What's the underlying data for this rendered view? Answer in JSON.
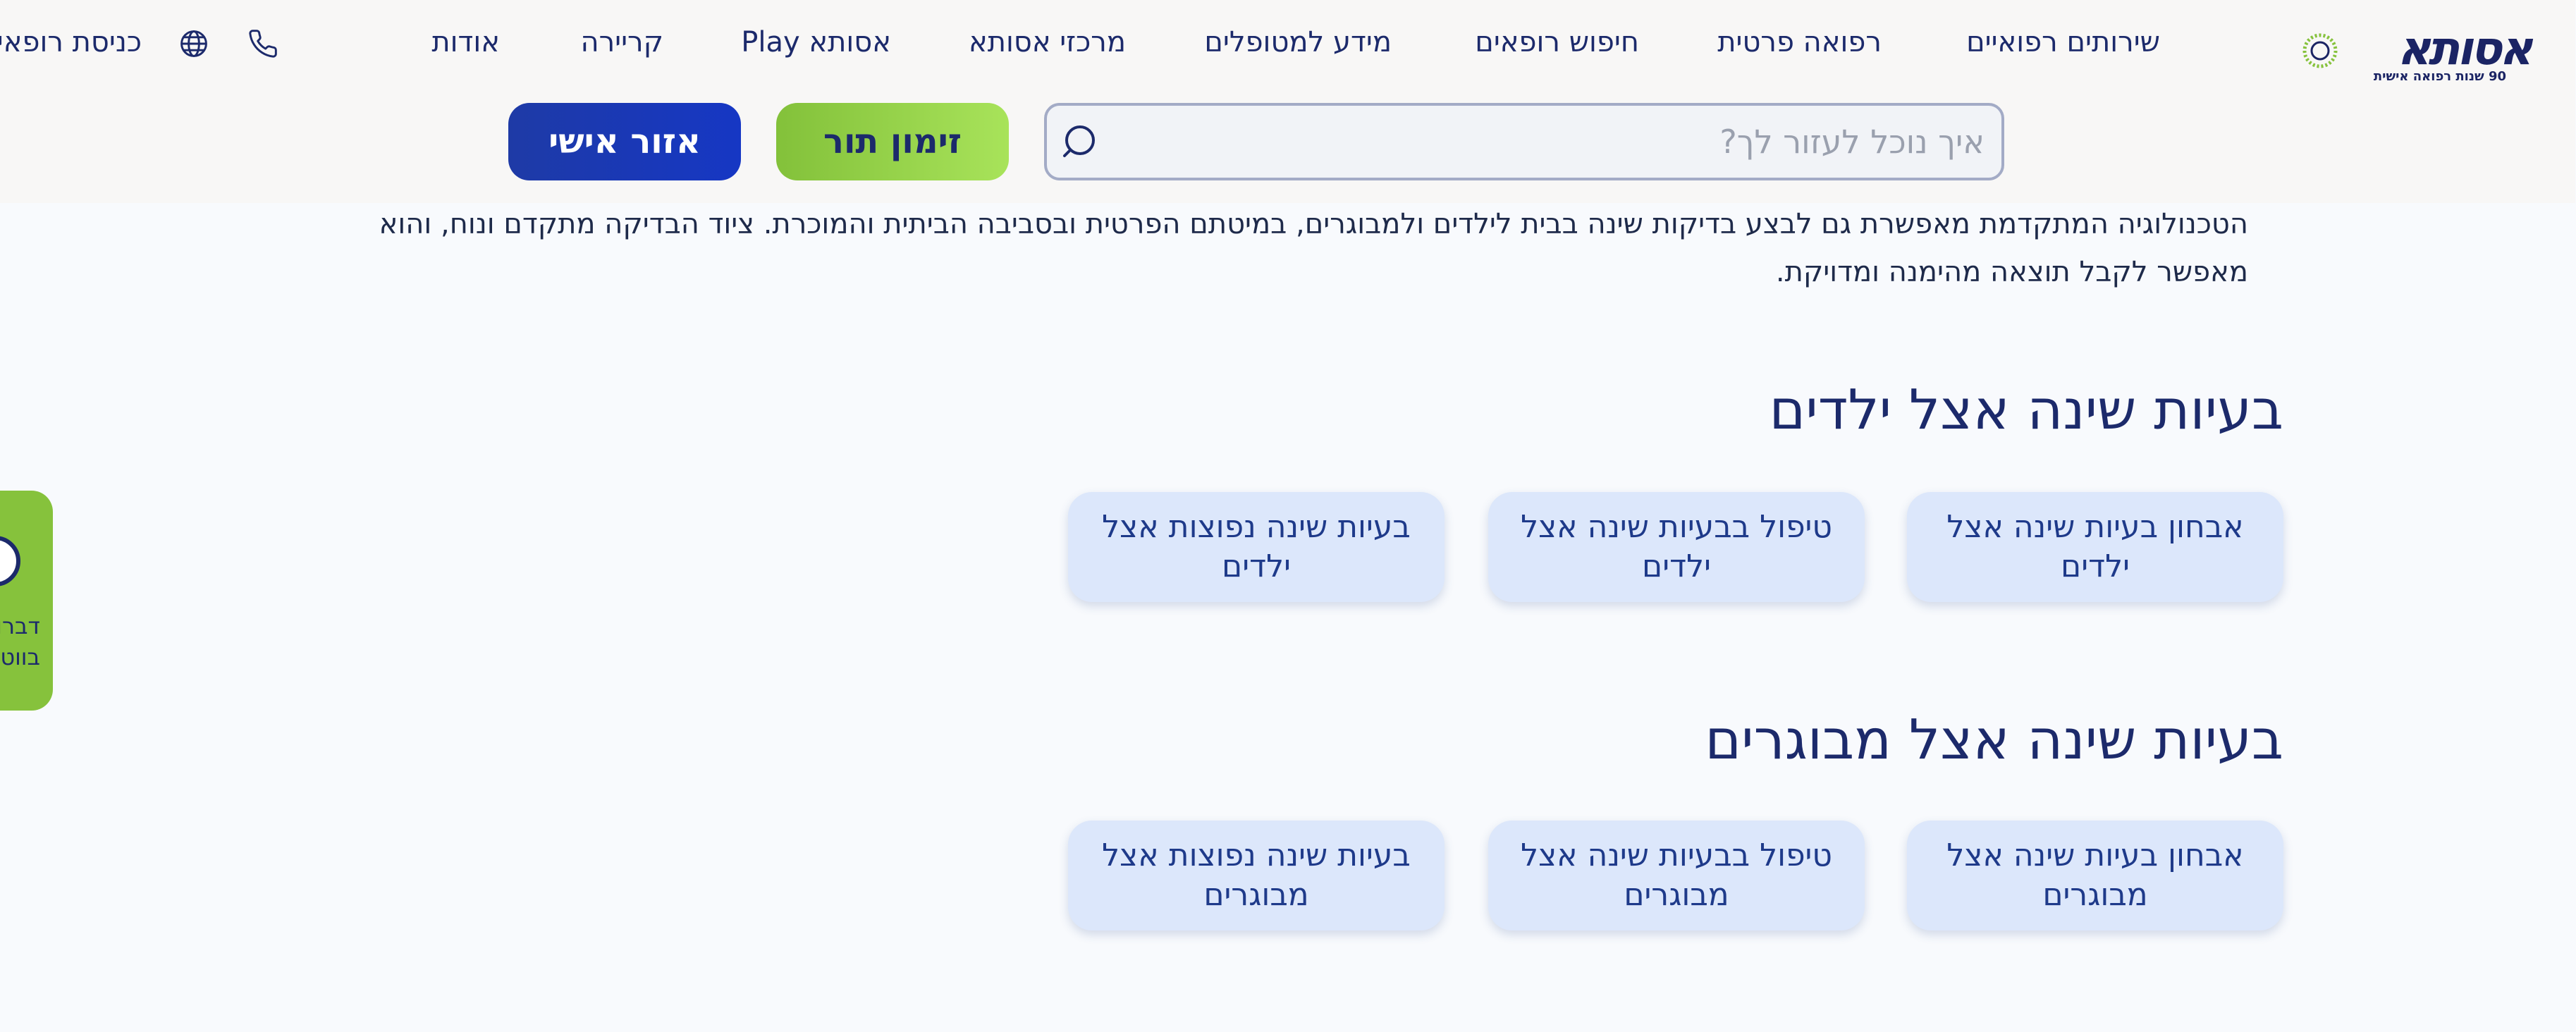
{
  "header": {
    "logo": {
      "wordmark": "אסותא",
      "tagline": "90 שנות רפואה אישית",
      "anniversary": "90"
    },
    "nav": [
      {
        "label": "שירותים רפואיים"
      },
      {
        "label": "רפואה פרטית"
      },
      {
        "label": "חיפוש רופאים"
      },
      {
        "label": "מידע למטופלים"
      },
      {
        "label": "מרכזי אסותא"
      },
      {
        "label": "אסותא Play"
      },
      {
        "label": "קריירה"
      },
      {
        "label": "אודות"
      }
    ],
    "icons": {
      "phone": "phone-icon",
      "language": "globe-icon"
    },
    "doctors_login": "כניסת רופאים"
  },
  "search": {
    "placeholder": "איך נוכל לעזור לך?",
    "value": "",
    "icon": "search-icon"
  },
  "buttons": {
    "appointment": "זימון תור",
    "personal_area": "אזור אישי"
  },
  "intro_paragraph": "הטכנולוגיה המתקדמת מאפשרת גם לבצע בדיקות שינה בבית לילדים ולמבוגרים, במיטתם הפרטית ובסביבה הביתית והמוכרת. ציוד הבדיקה מתקדם ונוח, והוא מאפשר לקבל תוצאה מהימנה ומדויקת.",
  "sections": [
    {
      "title": "בעיות שינה אצל ילדים",
      "cards": [
        {
          "label": "אבחון בעיות שינה אצל ילדים"
        },
        {
          "label": "טיפול בבעיות שינה אצל ילדים"
        },
        {
          "label": "בעיות שינה נפוצות אצל ילדים"
        }
      ]
    },
    {
      "title": "בעיות שינה אצל מבוגרים",
      "cards": [
        {
          "label": "אבחון בעיות שינה אצל מבוגרים"
        },
        {
          "label": "טיפול בבעיות שינה אצל מבוגרים"
        },
        {
          "label": "בעיות שינה נפוצות אצל מבוגרים"
        }
      ]
    }
  ],
  "side_tab": {
    "line1": "דברו",
    "line2": "בווטס"
  },
  "colors": {
    "brand_navy": "#1c2a6b",
    "accent_green": "#86c23c",
    "accent_blue": "#1637c4",
    "card_bg": "#dce7fb"
  }
}
